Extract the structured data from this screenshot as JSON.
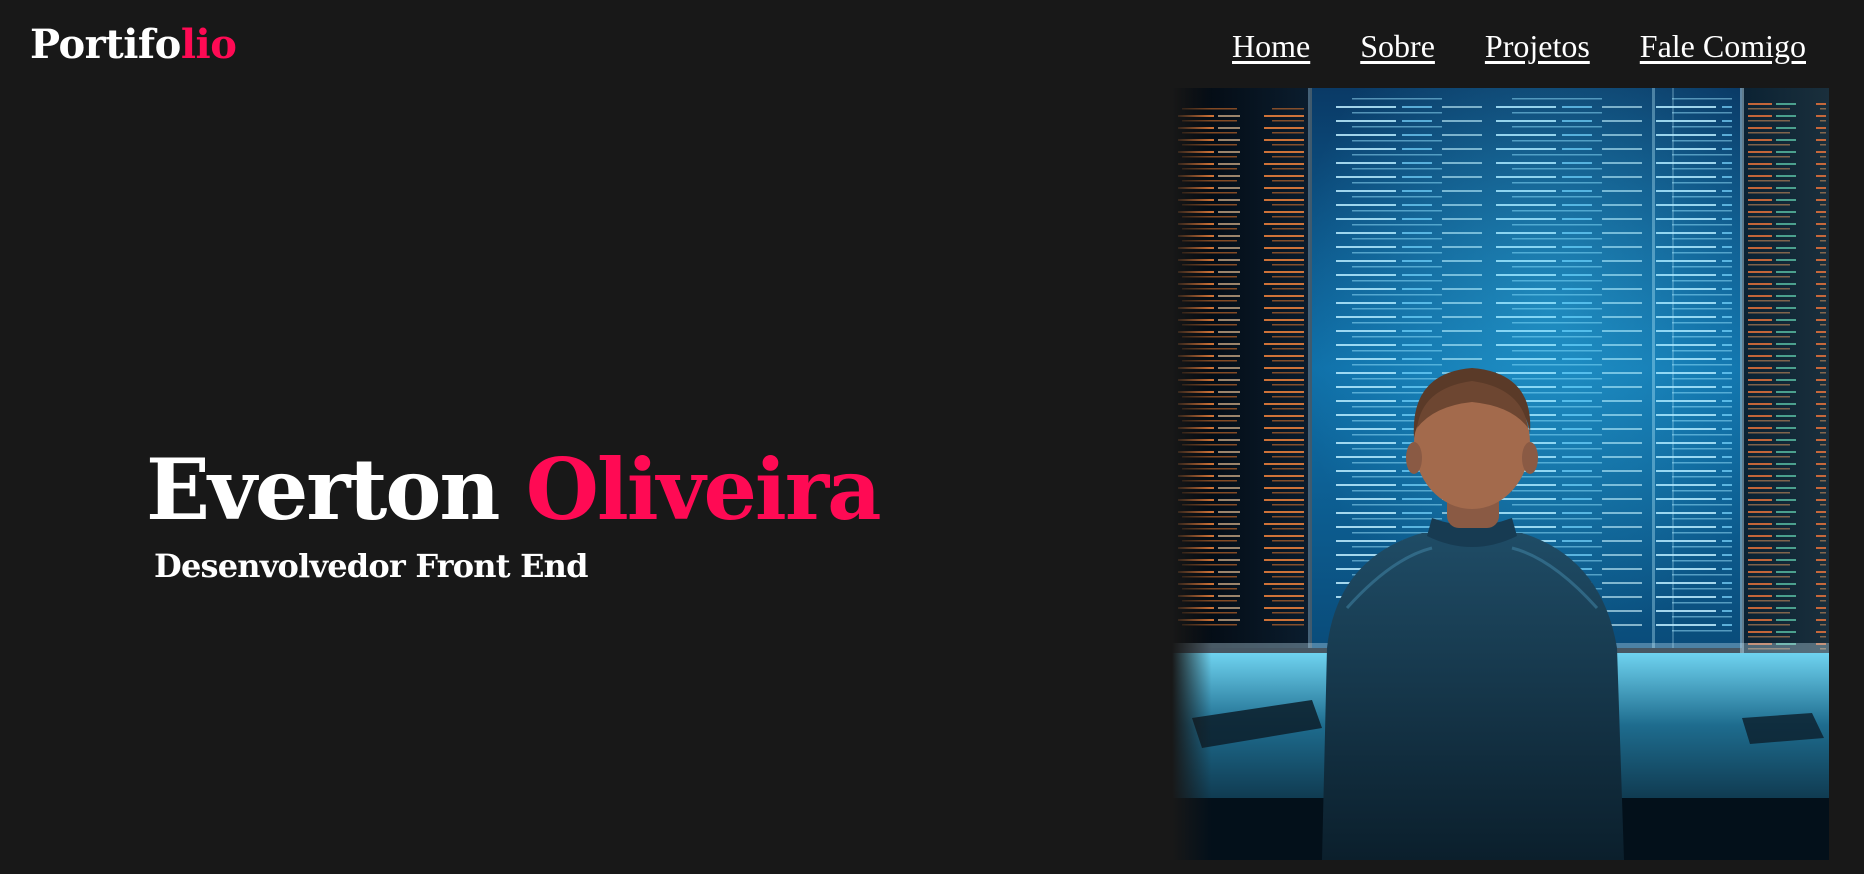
{
  "header": {
    "logo": {
      "main": "Portifo",
      "accent": "lio"
    },
    "nav": [
      {
        "label": "Home"
      },
      {
        "label": "Sobre"
      },
      {
        "label": "Projetos"
      },
      {
        "label": "Fale Comigo"
      }
    ]
  },
  "hero": {
    "first_name": "Everton",
    "last_name": "Oliveira",
    "role": "Desenvolvedor Front End"
  },
  "colors": {
    "background": "#181818",
    "text": "#ffffff",
    "accent": "#ff0a54"
  }
}
